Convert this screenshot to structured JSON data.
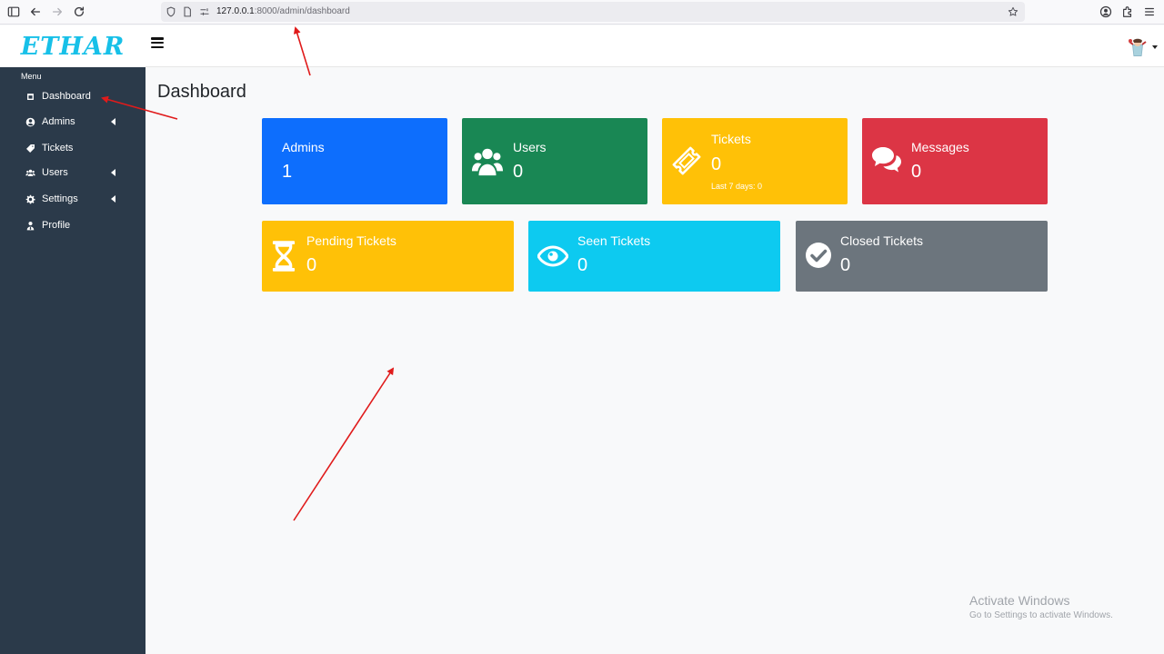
{
  "browser": {
    "url_host": "127.0.0.1",
    "url_path": ":8000/admin/dashboard",
    "icons": [
      "sidebar-toggle-icon",
      "back-arrow-icon",
      "forward-arrow-icon",
      "reload-icon",
      "shield-icon",
      "page-icon",
      "permissions-icon",
      "bookmark-star-icon",
      "account-icon",
      "extensions-icon",
      "menu-icon"
    ]
  },
  "brand": "ETHAR",
  "sidebar": {
    "heading": "Menu",
    "items": [
      {
        "label": "Dashboard",
        "icon": "dashboard-icon"
      },
      {
        "label": "Admins",
        "icon": "user-circle-icon",
        "has_submenu": true
      },
      {
        "label": "Tickets",
        "icon": "tag-icon"
      },
      {
        "label": "Users",
        "icon": "users-icon",
        "has_submenu": true
      },
      {
        "label": "Settings",
        "icon": "gear-icon",
        "has_submenu": true
      },
      {
        "label": "Profile",
        "icon": "user-tie-icon"
      }
    ]
  },
  "page": {
    "title": "Dashboard"
  },
  "cards": [
    {
      "label": "Admins",
      "value": "1",
      "color": "#0d6efd"
    },
    {
      "label": "Users",
      "value": "0",
      "color": "#198754",
      "icon": "users-icon"
    },
    {
      "label": "Tickets",
      "value": "0",
      "note": "Last 7 days: 0",
      "color": "#ffc107",
      "icon": "ticket-icon"
    },
    {
      "label": "Messages",
      "value": "0",
      "color": "#dc3545",
      "icon": "comments-icon"
    },
    {
      "label": "Pending Tickets",
      "value": "0",
      "color": "#ffc107",
      "icon": "hourglass-icon"
    },
    {
      "label": "Seen Tickets",
      "value": "0",
      "color": "#0dcaf0",
      "icon": "eye-icon"
    },
    {
      "label": "Closed Tickets",
      "value": "0",
      "color": "#6c757d",
      "icon": "check-circle-icon"
    }
  ],
  "watermark": {
    "line1": "Activate Windows",
    "line2": "Go to Settings to activate Windows."
  },
  "annotation_color": "#e01b1b"
}
